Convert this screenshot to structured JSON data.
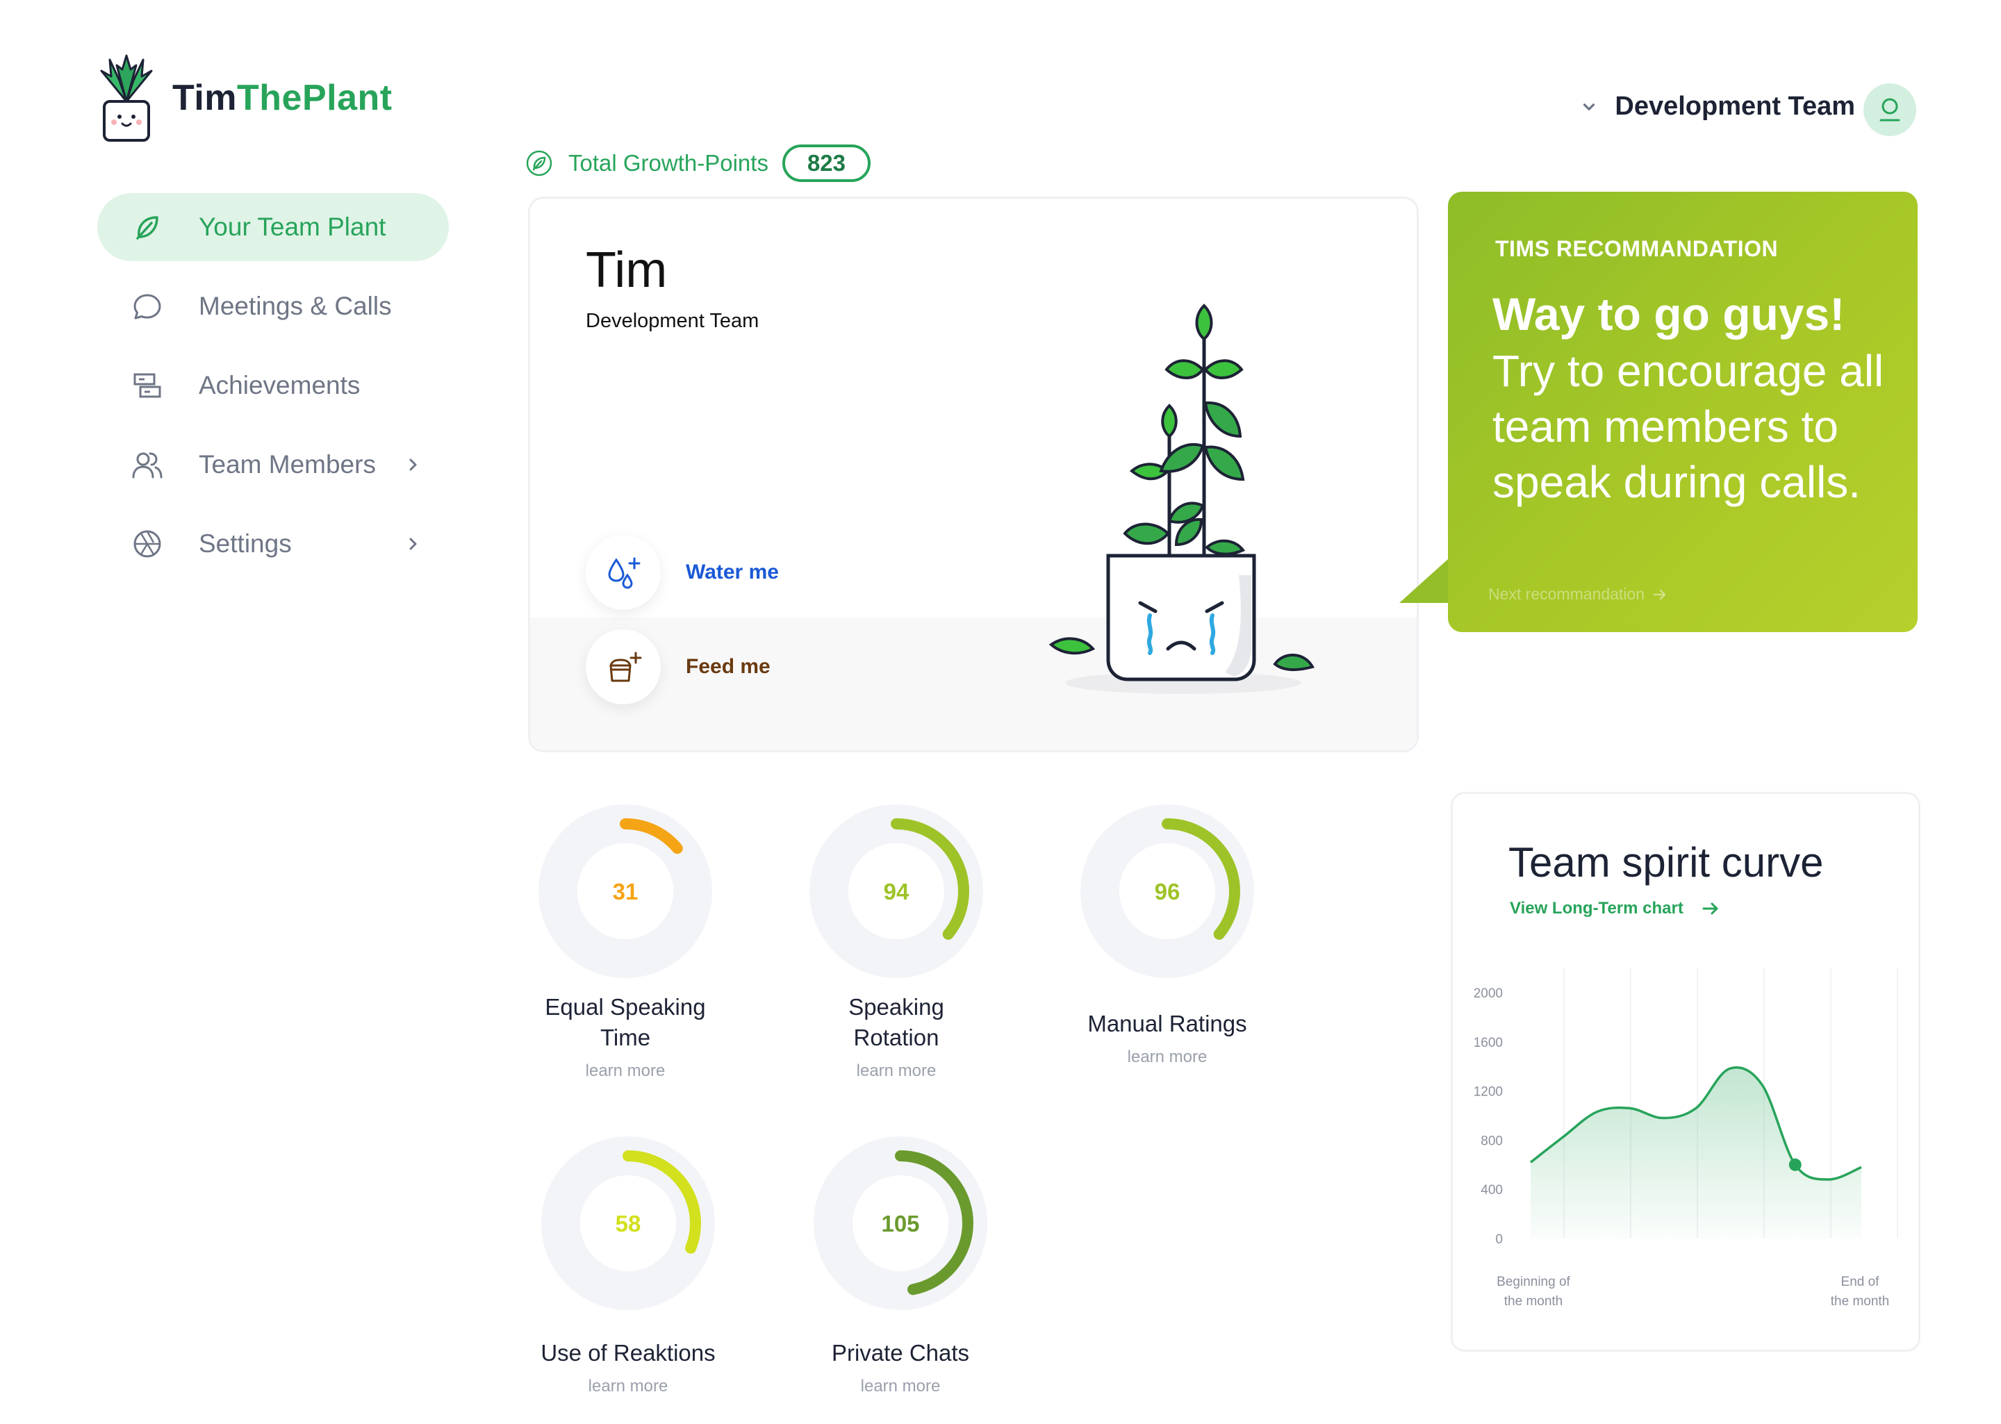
{
  "app": {
    "name_part1": "Tim",
    "name_part2": "ThePlant"
  },
  "sidebar": {
    "items": [
      {
        "label": "Your Team Plant",
        "icon": "leaf-icon",
        "active": true
      },
      {
        "label": "Meetings & Calls",
        "icon": "chat-bubble-icon"
      },
      {
        "label": "Achievements",
        "icon": "achievements-icon"
      },
      {
        "label": "Team Members",
        "icon": "users-icon",
        "has_submenu": true
      },
      {
        "label": "Settings",
        "icon": "aperture-icon",
        "has_submenu": true
      }
    ]
  },
  "header": {
    "team_label": "Development Team",
    "avatar_icon": "user-icon"
  },
  "growth": {
    "label": "Total Growth-Points",
    "value": "823"
  },
  "plant_card": {
    "name": "Tim",
    "team": "Development Team",
    "actions": [
      {
        "label": "Water me",
        "icon": "water-drops-plus-icon",
        "color": "#1a58d6"
      },
      {
        "label": "Feed me",
        "icon": "fertilizer-bag-plus-icon",
        "color": "#6a3a10"
      }
    ],
    "mood": "crying"
  },
  "recommendation": {
    "title": "TIMS RECOMMANDATION",
    "headline": "Way to go guys!",
    "body": "Try to encourage all team members to speak during calls.",
    "next_label": "Next recommandation"
  },
  "metrics": [
    {
      "value": "31",
      "label": "Equal Speaking Time",
      "more": "learn more",
      "fraction": 0.14,
      "color": "#f5a415"
    },
    {
      "value": "94",
      "label": "Speaking Rotation",
      "more": "learn more",
      "fraction": 0.36,
      "color": "#9ec328"
    },
    {
      "value": "96",
      "label": "Manual Ratings",
      "more": "learn more",
      "fraction": 0.36,
      "color": "#9ec328"
    },
    {
      "value": "58",
      "label": "Use of Reaktions",
      "more": "learn more",
      "fraction": 0.31,
      "color": "#d2e01e"
    },
    {
      "value": "105",
      "label": "Private Chats",
      "more": "learn more",
      "fraction": 0.47,
      "color": "#6a9a2e"
    }
  ],
  "spirit_chart": {
    "title": "Team spirit curve",
    "link_label": "View Long-Term chart",
    "chart_data": {
      "type": "area",
      "y_ticks": [
        "2000",
        "1600",
        "1200",
        "800",
        "400",
        "0"
      ],
      "ylim": [
        0,
        2000
      ],
      "x_start_label": "Beginning of the month",
      "x_end_label": "End of the month",
      "x": [
        0,
        1,
        2,
        3,
        4,
        5,
        6,
        7,
        8,
        9,
        10
      ],
      "values": [
        620,
        830,
        1030,
        1060,
        980,
        1060,
        1380,
        1250,
        600,
        480,
        580
      ],
      "highlight_index": 8,
      "color": "#27a45a"
    }
  }
}
